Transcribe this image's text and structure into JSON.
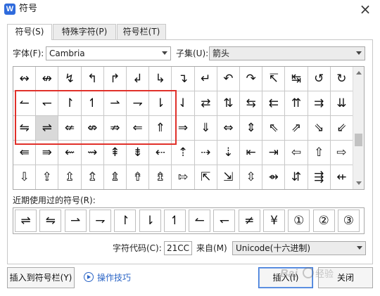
{
  "window": {
    "title": "符号",
    "app_icon_letter": "W"
  },
  "tabs": [
    {
      "label": "符号(S)",
      "active": true
    },
    {
      "label": "特殊字符(P)",
      "active": false
    },
    {
      "label": "符号栏(T)",
      "active": false
    }
  ],
  "font": {
    "label": "字体(F):",
    "value": "Cambria"
  },
  "subset": {
    "label": "子集(U):",
    "value": "箭头"
  },
  "symbol_grid": [
    [
      "↭",
      "↮",
      "↯",
      "↰",
      "↱",
      "↲",
      "↳",
      "↴",
      "↵",
      "↶",
      "↷",
      "↸",
      "↹",
      "↺",
      "↻"
    ],
    [
      "↼",
      "↽",
      "↾",
      "↿",
      "⇀",
      "⇁",
      "⇂",
      "⇃",
      "⇄",
      "⇅",
      "⇆",
      "⇇",
      "⇈",
      "⇉",
      "⇊"
    ],
    [
      "⇋",
      "⇌",
      "⇍",
      "⇎",
      "⇏",
      "⇐",
      "⇑",
      "⇒",
      "⇓",
      "⇔",
      "⇕",
      "⇖",
      "⇗",
      "⇘",
      "⇙"
    ],
    [
      "⇚",
      "⇛",
      "⇜",
      "⇝",
      "⇞",
      "⇟",
      "⇠",
      "⇡",
      "⇢",
      "⇣",
      "⇤",
      "⇥",
      "⇦",
      "⇧",
      "⇨"
    ],
    [
      "⇩",
      "⇪",
      "⇫",
      "⇬",
      "⇭",
      "⇮",
      "⇯",
      "⇰",
      "⇱",
      "⇲",
      "⇳",
      "⇴",
      "⇵",
      "⇶",
      "⇷"
    ]
  ],
  "selected_symbol": "⇌",
  "recent": {
    "label": "近期使用过的符号(R):",
    "symbols": [
      "⇌",
      "⇋",
      "⇀",
      "⇁",
      "↾",
      "⇂",
      "↿",
      "↼",
      "↽",
      "≠",
      "¥",
      "①",
      "②",
      "③"
    ]
  },
  "char_code": {
    "label": "字符代码(C):",
    "value": "21CC"
  },
  "from": {
    "label": "来自(M)",
    "value": "Unicode(十六进制)"
  },
  "buttons": {
    "insert_to_bar": "插入到符号栏(Y)",
    "tips": "操作技巧",
    "insert": "插入(I)",
    "close": "关闭"
  },
  "watermark_text": "Baidu 经验"
}
